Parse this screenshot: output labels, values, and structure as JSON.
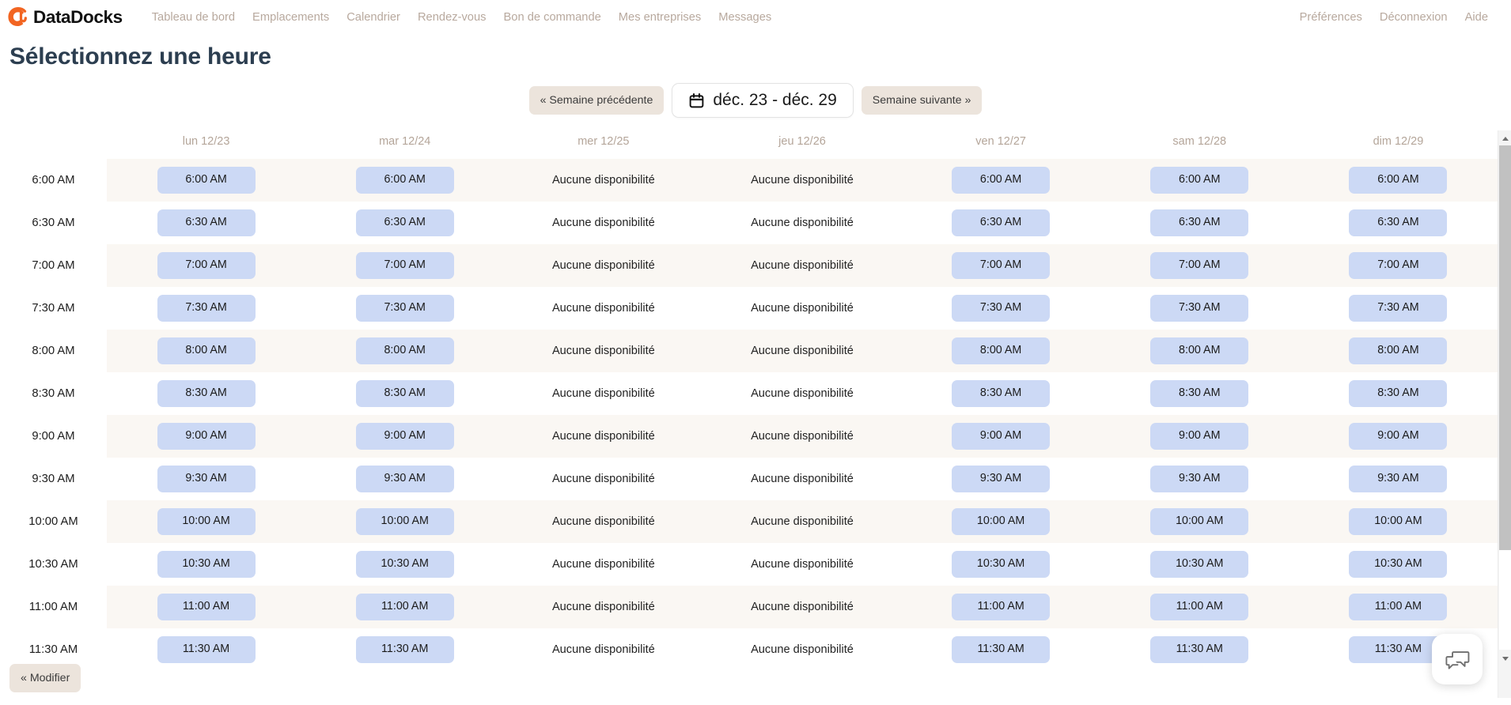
{
  "brand": {
    "name": "DataDocks",
    "logo_icon": "datadocks-logo-icon",
    "accent_color": "#f26522"
  },
  "nav": {
    "links": [
      {
        "label": "Tableau de bord"
      },
      {
        "label": "Emplacements"
      },
      {
        "label": "Calendrier"
      },
      {
        "label": "Rendez-vous"
      },
      {
        "label": "Bon de commande"
      },
      {
        "label": "Mes entreprises"
      },
      {
        "label": "Messages"
      }
    ],
    "right_links": [
      {
        "label": "Préférences"
      },
      {
        "label": "Déconnexion"
      },
      {
        "label": "Aide"
      }
    ]
  },
  "page": {
    "title": "Sélectionnez une heure"
  },
  "week_nav": {
    "prev_label": "« Semaine précédente",
    "next_label": "Semaine suivante »",
    "range_label": "déc. 23 - déc. 29",
    "calendar_icon": "calendar-icon"
  },
  "schedule": {
    "time_column_header": "",
    "days": [
      {
        "label": "lun 12/23",
        "available": true
      },
      {
        "label": "mar 12/24",
        "available": true
      },
      {
        "label": "mer 12/25",
        "available": false
      },
      {
        "label": "jeu 12/26",
        "available": false
      },
      {
        "label": "ven 12/27",
        "available": true
      },
      {
        "label": "sam 12/28",
        "available": true
      },
      {
        "label": "dim 12/29",
        "available": true
      }
    ],
    "unavailable_text": "Aucune disponibilité",
    "rows": [
      {
        "time": "6:00 AM"
      },
      {
        "time": "6:30 AM"
      },
      {
        "time": "7:00 AM"
      },
      {
        "time": "7:30 AM"
      },
      {
        "time": "8:00 AM"
      },
      {
        "time": "8:30 AM"
      },
      {
        "time": "9:00 AM"
      },
      {
        "time": "9:30 AM"
      },
      {
        "time": "10:00 AM"
      },
      {
        "time": "10:30 AM"
      },
      {
        "time": "11:00 AM"
      },
      {
        "time": "11:30 AM"
      }
    ],
    "slot_color": "#ccd9f5"
  },
  "footer": {
    "back_label": "« Modifier"
  },
  "chat": {
    "icon": "chat-bubbles-icon"
  }
}
